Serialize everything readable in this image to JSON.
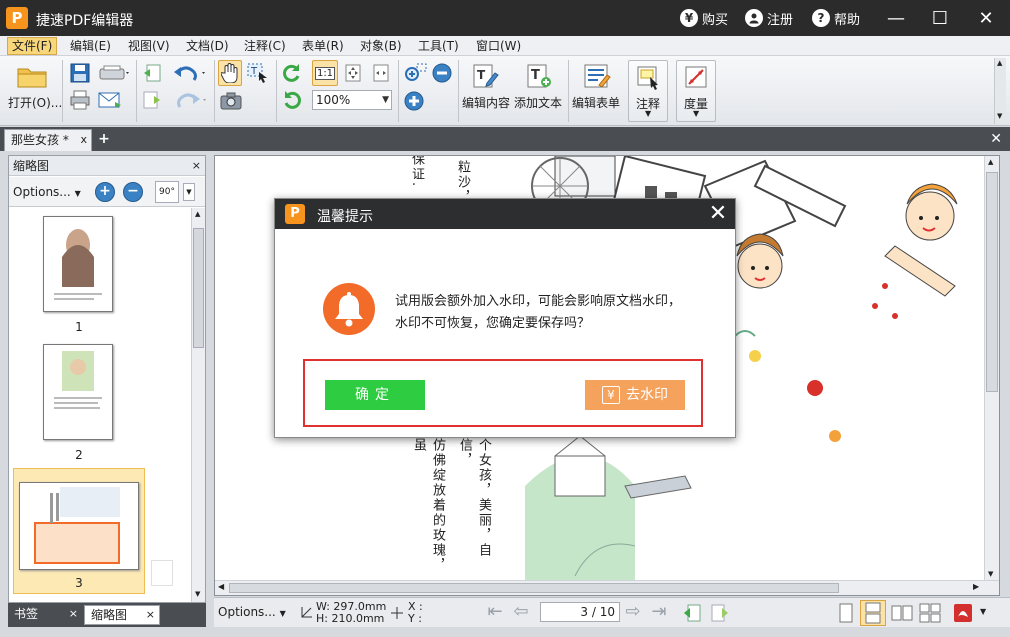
{
  "app": {
    "logo": "P",
    "title": "捷速PDF编辑器"
  },
  "titlebar": {
    "buy": {
      "icon": "¥",
      "label": "购买"
    },
    "register": {
      "label": "注册"
    },
    "help": {
      "icon": "?",
      "label": "帮助"
    },
    "minimize": "—",
    "maximize": "☐",
    "close": "✕"
  },
  "menu": [
    "文件(F)",
    "编辑(E)",
    "视图(V)",
    "文档(D)",
    "注释(C)",
    "表单(R)",
    "对象(B)",
    "工具(T)",
    "窗口(W)"
  ],
  "toolbar": {
    "open_label": "打开(O)...",
    "zoom_value": "100%",
    "edit_content": "编辑内容",
    "add_text": "添加文本",
    "edit_form": "编辑表单",
    "annotate": "注释",
    "measure": "度量",
    "actual_size": "1:1"
  },
  "doc_tab": {
    "label": "那些女孩 *",
    "close": "x",
    "add": "+",
    "close_all": "✕"
  },
  "left_panel": {
    "title": "缩略图",
    "close": "×",
    "options": "Options...",
    "rotate_label": "90°",
    "thumbnails": [
      {
        "number": "1"
      },
      {
        "number": "2"
      },
      {
        "number": "3"
      }
    ],
    "tabs": [
      {
        "label": "书签",
        "close": "×"
      },
      {
        "label": "缩略图",
        "close": "×"
      }
    ]
  },
  "document": {
    "vertical_lines": [
      "保证.",
      "粒沙，",
      "仿佛绽放着的玫瑰，虽",
      "个女孩，美丽，自信，"
    ]
  },
  "statusbar": {
    "options": "Options...",
    "width": "W: 297.0mm",
    "height": "H: 210.0mm",
    "x": "X :",
    "y": "Y :",
    "page": "3 / 10"
  },
  "dialog": {
    "logo": "P",
    "title": "温馨提示",
    "close": "✕",
    "message_line1": "试用版会额外加入水印，可能会影响原文档水印，",
    "message_line2": "水印不可恢复，您确定要保存吗？",
    "ok_label": "确定",
    "remove_watermark_icon": "¥",
    "remove_watermark_label": "去水印"
  },
  "colors": {
    "titlebar": "#2b2b2b",
    "brand_orange": "#f7941d",
    "ok_green": "#2ecc40",
    "watermark_orange": "#f5a25d",
    "highlight_red": "#e03030",
    "bell_orange": "#f26b28"
  }
}
